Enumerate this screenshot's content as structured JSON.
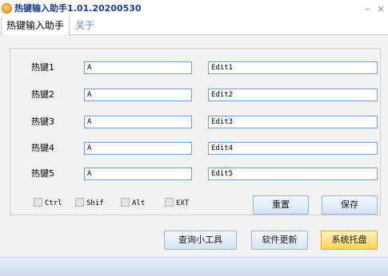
{
  "window": {
    "title": "热键输入助手1.01.20200530",
    "minimize_label": "–",
    "close_label": "×"
  },
  "tabs": [
    {
      "label": "热键输入助手",
      "active": true
    },
    {
      "label": "关于",
      "active": false
    }
  ],
  "hotkeys": [
    {
      "label": "热键1",
      "key": "A",
      "text": "Edit1"
    },
    {
      "label": "热键2",
      "key": "A",
      "text": "Edit2"
    },
    {
      "label": "热键3",
      "key": "A",
      "text": "Edit3"
    },
    {
      "label": "热键4",
      "key": "A",
      "text": "Edit4"
    },
    {
      "label": "热键5",
      "key": "A",
      "text": "Edit5"
    }
  ],
  "modifiers": [
    {
      "label": "Ctrl",
      "checked": false
    },
    {
      "label": "Shif",
      "checked": false
    },
    {
      "label": "Alt",
      "checked": false
    },
    {
      "label": "EXT",
      "checked": false
    }
  ],
  "buttons": {
    "reset": "重置",
    "save": "保存",
    "query_tool": "查询小工具",
    "update": "软件更新",
    "tray": "系统托盘"
  },
  "colors": {
    "title_text": "#1a3f8a",
    "button_bg": "#d6e3f6",
    "tray_button_bg": "#ffd35c"
  }
}
